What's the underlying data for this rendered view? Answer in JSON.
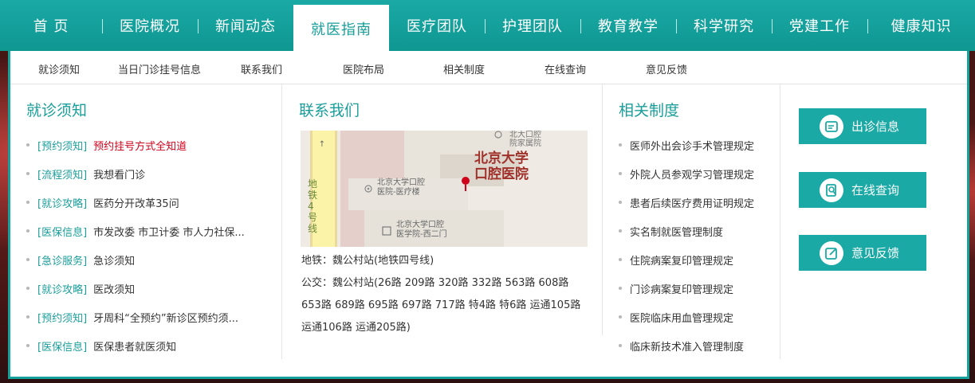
{
  "topnav": {
    "items": [
      {
        "label": "首 页"
      },
      {
        "label": "医院概况"
      },
      {
        "label": "新闻动态"
      },
      {
        "label": "就医指南"
      },
      {
        "label": "医疗团队"
      },
      {
        "label": "护理团队"
      },
      {
        "label": "教育教学"
      },
      {
        "label": "科学研究"
      },
      {
        "label": "党建工作"
      },
      {
        "label": "健康知识"
      }
    ],
    "active_index": 3
  },
  "subnav": {
    "items": [
      {
        "label": "就诊须知"
      },
      {
        "label": "当日门诊挂号信息"
      },
      {
        "label": "联系我们"
      },
      {
        "label": "医院布局"
      },
      {
        "label": "相关制度"
      },
      {
        "label": "在线查询"
      },
      {
        "label": "意见反馈"
      }
    ]
  },
  "notice": {
    "title": "就诊须知",
    "items": [
      {
        "tag": "[预约须知]",
        "text": "预约挂号方式全知道",
        "highlight": true
      },
      {
        "tag": "[流程须知]",
        "text": "我想看门诊"
      },
      {
        "tag": "[就诊攻略]",
        "text": "医药分开改革35问"
      },
      {
        "tag": "[医保信息]",
        "text": "市发改委 市卫计委 市人力社保..."
      },
      {
        "tag": "[急诊服务]",
        "text": "急诊须知"
      },
      {
        "tag": "[就诊攻略]",
        "text": "医改须知"
      },
      {
        "tag": "[预约须知]",
        "text": "牙周科“全预约”新诊区预约须..."
      },
      {
        "tag": "[医保信息]",
        "text": "医保患者就医须知"
      }
    ]
  },
  "contact": {
    "title": "联系我们",
    "map": {
      "hospital_name_line1": "北京大学",
      "hospital_name_line2": "口腔医院",
      "label_family_line1": "北大口腔",
      "label_family_line2": "院家属院",
      "label_clinic_line1": "北京大学口腔",
      "label_clinic_line2": "医院-医疗楼",
      "label_gate_line1": "北京大学口腔",
      "label_gate_line2": "医学院-西二门",
      "label_subway": "地铁4号线"
    },
    "subway": "地铁：魏公村站(地铁四号线)",
    "bus_line1": "公交：魏公村站(26路 209路 320路 332路 563路 608路",
    "bus_line2": "653路 689路 695路 697路 717路 特4路 特6路 运通105路",
    "bus_line3": "运通106路 运通205路)"
  },
  "rules": {
    "title": "相关制度",
    "items": [
      {
        "text": "医师外出会诊手术管理规定"
      },
      {
        "text": "外院人员参观学习管理规定"
      },
      {
        "text": "患者后续医疗费用证明规定"
      },
      {
        "text": "实名制就医管理制度"
      },
      {
        "text": "住院病案复印管理规定"
      },
      {
        "text": "门诊病案复印管理规定"
      },
      {
        "text": "医院临床用血管理规定"
      },
      {
        "text": "临床新技术准入管理制度"
      }
    ]
  },
  "quick_buttons": [
    {
      "label": "出诊信息",
      "icon": "schedule-icon"
    },
    {
      "label": "在线查询",
      "icon": "search-doc-icon"
    },
    {
      "label": "意见反馈",
      "icon": "edit-icon"
    }
  ],
  "colors": {
    "accent": "#1aa9a5",
    "title": "#1a9e9a",
    "highlight": "#d0021b"
  }
}
